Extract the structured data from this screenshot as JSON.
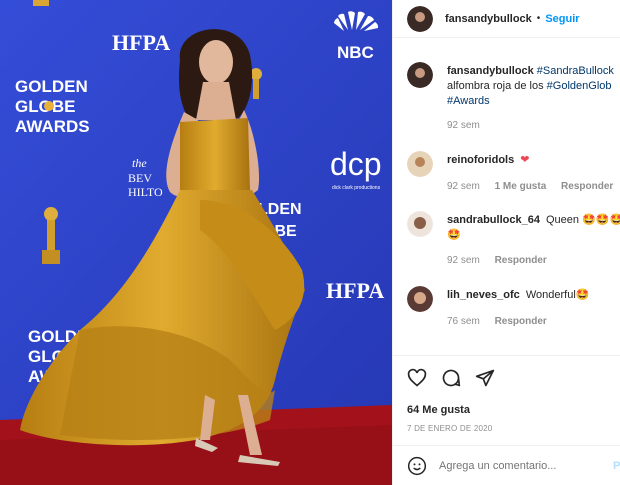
{
  "photo": {
    "sponsor_text_1": "HFPA",
    "sponsor_text_2": "NBC",
    "sponsor_text_3": "dcp",
    "sponsor_text_3_sub": "dick clark productions",
    "sponsor_text_4": "HFPA",
    "hotel_text_1": "the",
    "hotel_text_2": "BEV",
    "hotel_text_3": "HILTO",
    "globe_line_1": "GOLDEN",
    "globe_line_2": "GLOBE",
    "globe_line_3": "AWARDS",
    "right_partial_1": "LDEN",
    "right_partial_2": "OBE"
  },
  "header": {
    "username": "fansandybullock",
    "separator": "•",
    "follow_label": "Seguir"
  },
  "caption": {
    "username": "fansandybullock",
    "text_hashtag_1": "#SandraBullock",
    "text_line_2": "alfombra roja de los",
    "text_hashtag_2": "#GoldenGlob",
    "text_hashtag_3": "#Awards",
    "time": "92 sem"
  },
  "comments": [
    {
      "username": "reinoforidols",
      "text": "❤",
      "time": "92 sem",
      "likes": "1 Me gusta",
      "reply": "Responder"
    },
    {
      "username": "sandrabullock_64",
      "text": "Queen 🤩🤩🤩",
      "text_line_2": "🤩",
      "time": "92 sem",
      "reply": "Responder"
    },
    {
      "username": "lih_neves_ofc",
      "text": "Wonderful🤩",
      "time": "76 sem",
      "reply": "Responder"
    }
  ],
  "actions": {
    "likes": "64 Me gusta",
    "date": "7 DE ENERO DE 2020"
  },
  "add_comment": {
    "placeholder": "Agrega un comentario...",
    "post_label": "P"
  },
  "colors": {
    "backdrop": "#2a3ec8",
    "carpet": "#a3121a",
    "dress": "#d19a1f",
    "link": "#00376b",
    "follow": "#0095f6",
    "heart": "#ed4956"
  }
}
